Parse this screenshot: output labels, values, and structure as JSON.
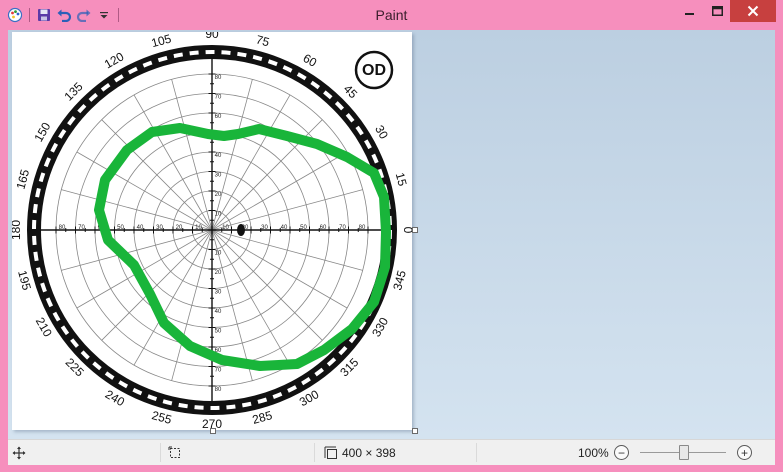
{
  "window": {
    "title": "Paint",
    "colors": {
      "frame": "#f68fbd",
      "close": "#c7403f",
      "workspace": "#c4d6e8",
      "trace": "#19b53a"
    }
  },
  "qat": {
    "icons": [
      "paint-app-icon",
      "save-icon",
      "undo-icon",
      "redo-icon",
      "customize-dropdown-icon"
    ]
  },
  "image": {
    "eye_label": "OD",
    "scale_labels": [
      "10",
      "20",
      "30",
      "40",
      "50",
      "60",
      "70",
      "80"
    ],
    "angle_labels": [
      {
        "text": "0",
        "deg": 0
      },
      {
        "text": "15",
        "deg": 15
      },
      {
        "text": "30",
        "deg": 30
      },
      {
        "text": "45",
        "deg": 45
      },
      {
        "text": "60",
        "deg": 60
      },
      {
        "text": "75",
        "deg": 75
      },
      {
        "text": "90",
        "deg": 90
      },
      {
        "text": "105",
        "deg": 105
      },
      {
        "text": "120",
        "deg": 120
      },
      {
        "text": "135",
        "deg": 135
      },
      {
        "text": "150",
        "deg": 150
      },
      {
        "text": "165",
        "deg": 165
      },
      {
        "text": "180",
        "deg": 180
      },
      {
        "text": "195",
        "deg": 195
      },
      {
        "text": "210",
        "deg": 210
      },
      {
        "text": "225",
        "deg": 225
      },
      {
        "text": "240",
        "deg": 240
      },
      {
        "text": "255",
        "deg": 255
      },
      {
        "text": "270",
        "deg": 270
      },
      {
        "text": "285",
        "deg": 285
      },
      {
        "text": "300",
        "deg": 300
      },
      {
        "text": "315",
        "deg": 315
      },
      {
        "text": "330",
        "deg": 330
      },
      {
        "text": "345",
        "deg": 345
      }
    ]
  },
  "status": {
    "canvas_size": "400 × 398",
    "zoom": "100%",
    "zoom_out": "−",
    "zoom_in": "+",
    "zoom_slider_value": 0.5
  }
}
